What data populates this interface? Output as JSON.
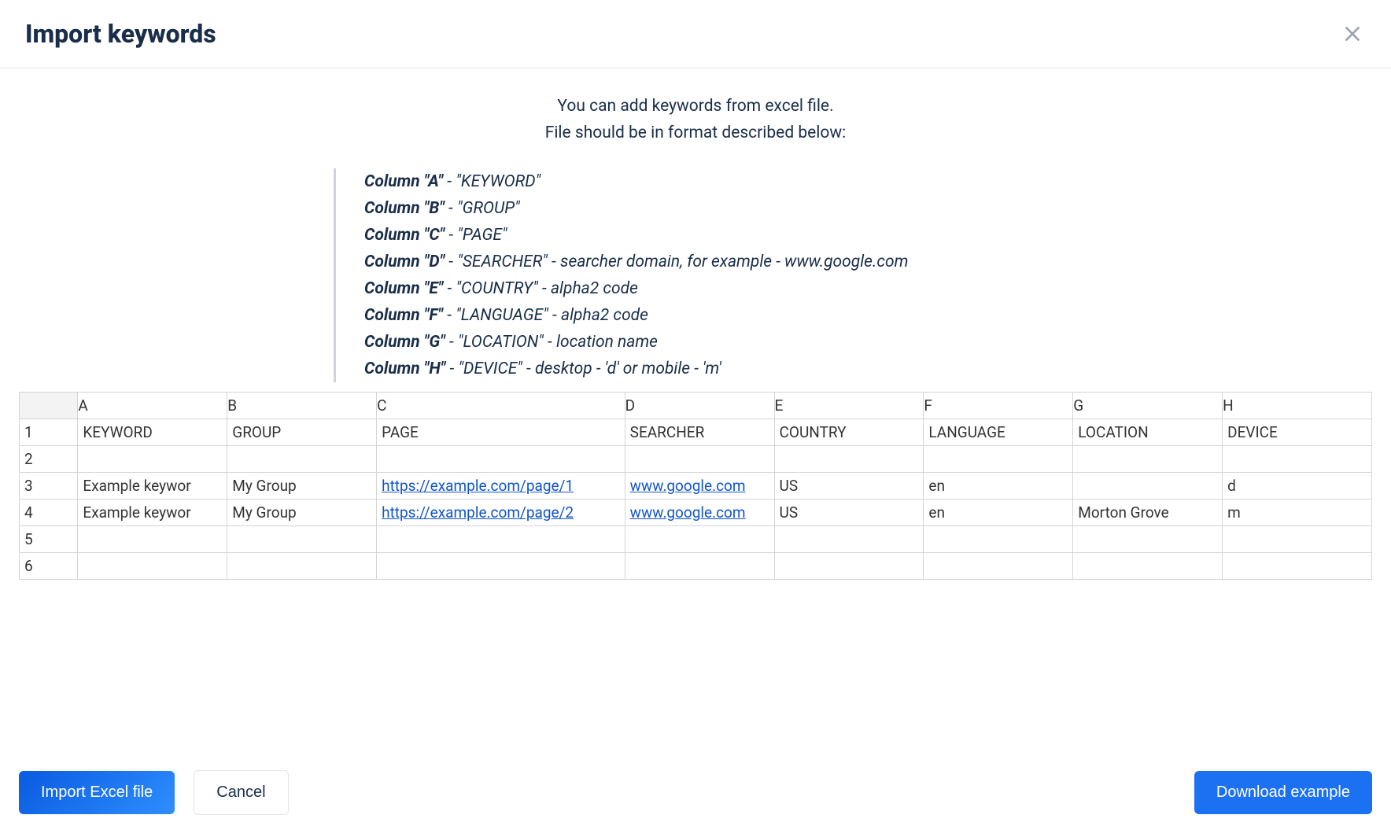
{
  "modal": {
    "title": "Import keywords",
    "intro_line1": "You can add keywords from excel file.",
    "intro_line2": "File should be in format described below:"
  },
  "columns_spec": [
    {
      "label": "Column \"A\"",
      "value": "\"KEYWORD\"",
      "extra": ""
    },
    {
      "label": "Column \"B\"",
      "value": "\"GROUP\"",
      "extra": ""
    },
    {
      "label": "Column \"C\"",
      "value": "\"PAGE\"",
      "extra": ""
    },
    {
      "label": "Column \"D\"",
      "value": "\"SEARCHER\"",
      "extra": "searcher domain, for example - www.google.com"
    },
    {
      "label": "Column \"E\"",
      "value": "\"COUNTRY\"",
      "extra": "alpha2 code"
    },
    {
      "label": "Column \"F\"",
      "value": "\"LANGUAGE\"",
      "extra": "alpha2 code"
    },
    {
      "label": "Column \"G\"",
      "value": "\"LOCATION\"",
      "extra": "location name"
    },
    {
      "label": "Column \"H\"",
      "value": "\"DEVICE\"",
      "extra": "desktop - 'd' or mobile - 'm'"
    }
  ],
  "spreadsheet": {
    "col_letters": [
      "A",
      "B",
      "C",
      "D",
      "E",
      "F",
      "G",
      "H"
    ],
    "header_row_num": "1",
    "header_row": [
      "KEYWORD",
      "GROUP",
      "PAGE",
      "SEARCHER",
      "COUNTRY",
      "LANGUAGE",
      "LOCATION",
      "DEVICE"
    ],
    "rows": [
      {
        "n": "2",
        "cells": [
          "",
          "",
          "",
          "",
          "",
          "",
          "",
          ""
        ],
        "link_cols": []
      },
      {
        "n": "3",
        "cells": [
          "Example keywor",
          "My Group",
          "https://example.com/page/1",
          "www.google.com",
          "US",
          "en",
          "",
          "d"
        ],
        "link_cols": [
          2,
          3
        ]
      },
      {
        "n": "4",
        "cells": [
          "Example keywor",
          "My Group",
          "https://example.com/page/2",
          "www.google.com",
          "US",
          "en",
          "Morton Grove",
          "m"
        ],
        "link_cols": [
          2,
          3
        ]
      },
      {
        "n": "5",
        "cells": [
          "",
          "",
          "",
          "",
          "",
          "",
          "",
          ""
        ],
        "link_cols": []
      },
      {
        "n": "6",
        "cells": [
          "",
          "",
          "",
          "",
          "",
          "",
          "",
          ""
        ],
        "link_cols": []
      }
    ]
  },
  "footer": {
    "import_label": "Import Excel file",
    "cancel_label": "Cancel",
    "download_label": "Download example"
  }
}
